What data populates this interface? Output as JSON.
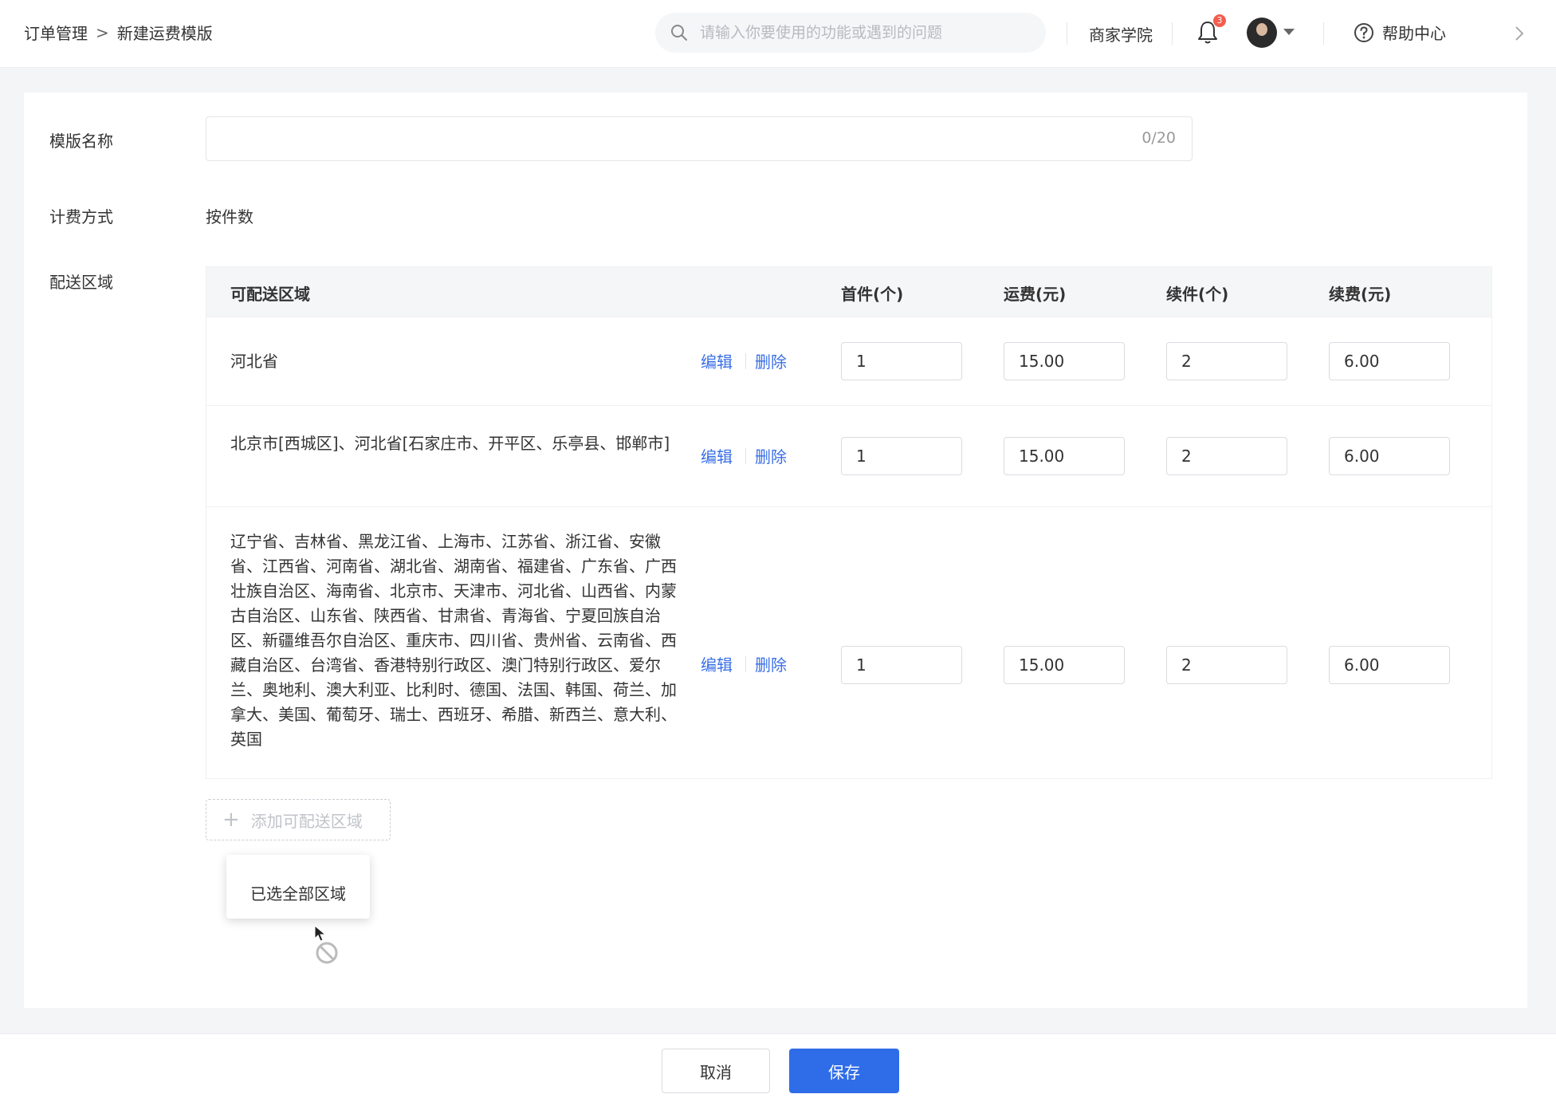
{
  "header": {
    "breadcrumb": [
      "订单管理",
      "新建运费模版"
    ],
    "breadcrumb_sep": ">",
    "search_placeholder": "请输入你要使用的功能或遇到的问题",
    "merchant_academy": "商家学院",
    "notification_count": "3",
    "help_center": "帮助中心"
  },
  "form": {
    "template_name_label": "模版名称",
    "template_name_value": "",
    "template_name_counter": "0/20",
    "billing_label": "计费方式",
    "billing_value": "按件数",
    "delivery_label": "配送区域"
  },
  "table": {
    "headers": [
      "可配送区域",
      "首件(个)",
      "运费(元)",
      "续件(个)",
      "续费(元)"
    ],
    "edit_label": "编辑",
    "delete_label": "删除",
    "rows": [
      {
        "region": "河北省",
        "first_qty": "1",
        "first_fee": "15.00",
        "extra_qty": "2",
        "extra_fee": "6.00"
      },
      {
        "region": "北京市[西城区]、河北省[石家庄市、开平区、乐亭县、邯郸市]",
        "first_qty": "1",
        "first_fee": "15.00",
        "extra_qty": "2",
        "extra_fee": "6.00"
      },
      {
        "region": "辽宁省、吉林省、黑龙江省、上海市、江苏省、浙江省、安徽省、江西省、河南省、湖北省、湖南省、福建省、广东省、广西壮族自治区、海南省、北京市、天津市、河北省、山西省、内蒙古自治区、山东省、陕西省、甘肃省、青海省、宁夏回族自治区、新疆维吾尔自治区、重庆市、四川省、贵州省、云南省、西藏自治区、台湾省、香港特别行政区、澳门特别行政区、爱尔兰、奥地利、澳大利亚、比利时、德国、法国、韩国、荷兰、加拿大、美国、葡萄牙、瑞士、西班牙、希腊、新西兰、意大利、英国",
        "first_qty": "1",
        "first_fee": "15.00",
        "extra_qty": "2",
        "extra_fee": "6.00"
      }
    ]
  },
  "add_region": {
    "label": "添加可配送区域",
    "tooltip": "已选全部区域"
  },
  "footer": {
    "cancel_label": "取消",
    "save_label": "保存"
  },
  "colors": {
    "accent": "#2f6de8",
    "link": "#3a6fe6",
    "badge": "#f25d4f"
  }
}
